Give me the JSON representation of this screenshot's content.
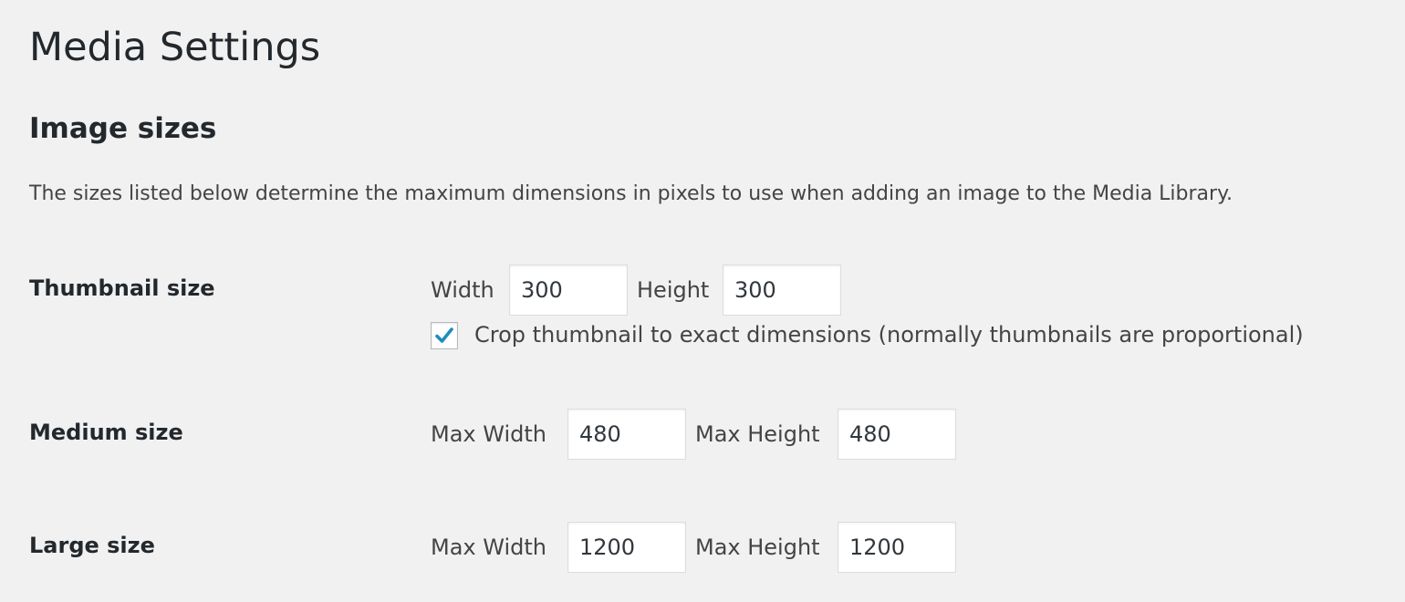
{
  "page": {
    "title": "Media Settings"
  },
  "section": {
    "title": "Image sizes",
    "description": "The sizes listed below determine the maximum dimensions in pixels to use when adding an image to the Media Library."
  },
  "thumbnail": {
    "label": "Thumbnail size",
    "width_label": "Width",
    "width_value": "300",
    "height_label": "Height",
    "height_value": "300",
    "crop_checked": true,
    "crop_label": "Crop thumbnail to exact dimensions (normally thumbnails are proportional)"
  },
  "medium": {
    "label": "Medium size",
    "width_label": "Max Width",
    "width_value": "480",
    "height_label": "Max Height",
    "height_value": "480"
  },
  "large": {
    "label": "Large size",
    "width_label": "Max Width",
    "width_value": "1200",
    "height_label": "Max Height",
    "height_value": "1200"
  },
  "colors": {
    "background": "#f1f1f1",
    "text": "#23282d",
    "checkmark": "#1e8cbe",
    "input_border": "#dddddd"
  },
  "icons": {
    "checkbox_check": "checkmark-icon"
  }
}
